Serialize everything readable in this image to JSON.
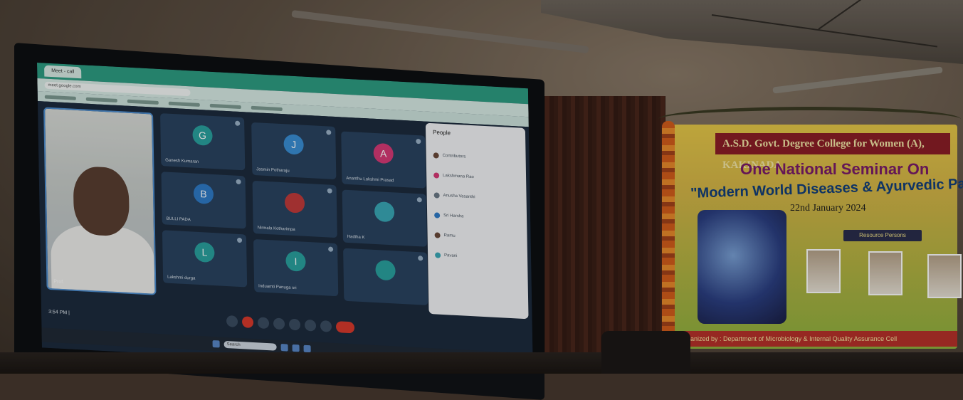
{
  "browser": {
    "tab_label": "Meet - call",
    "address": "meet.google.com"
  },
  "meeting": {
    "self_name": "Prof.",
    "time_line": "3:54 PM | ",
    "participants": [
      {
        "initial": "G",
        "name": "Ganesh Kumaran",
        "color": "#2aa3a0"
      },
      {
        "initial": "J",
        "name": "Jasmin Potharaju",
        "color": "#3a8fd6"
      },
      {
        "initial": "A",
        "name": "Ananthu Lakshmi Prasad",
        "color": "#d83a77"
      },
      {
        "initial": "B",
        "name": "BULLI PADA",
        "color": "#2f7cc9"
      },
      {
        "initial": "",
        "name": "Nirmala Kotharimpa",
        "color": "#c33b3b"
      },
      {
        "initial": "",
        "name": "Hadiha K",
        "color": "#3aa9b8"
      },
      {
        "initial": "L",
        "name": "Lakshmi durga",
        "color": "#2aa3a0"
      },
      {
        "initial": "I",
        "name": "Induamti Panuga sri",
        "color": "#2aa3a0"
      },
      {
        "initial": "",
        "name": "",
        "color": "#2aa3a0"
      }
    ],
    "people_panel": {
      "header": "People",
      "rows": [
        "Contributors",
        "Lakshmana Rao",
        "Anusha Vasanthi",
        "Sri Harsha",
        "Ramu",
        "Pavani"
      ]
    }
  },
  "taskbar": {
    "search_placeholder": "Search"
  },
  "banner": {
    "college": "A.S.D. Govt. Degree College for Women (A), KAKINADA",
    "seminar": "One National Seminar On",
    "title": "\"Modern World Diseases & Ayurvedic Panacea\"",
    "date": "22nd January 2024",
    "speakers_label": "Resource Persons",
    "footer": "Organized by : Department of Microbiology & Internal Quality Assurance Cell"
  }
}
